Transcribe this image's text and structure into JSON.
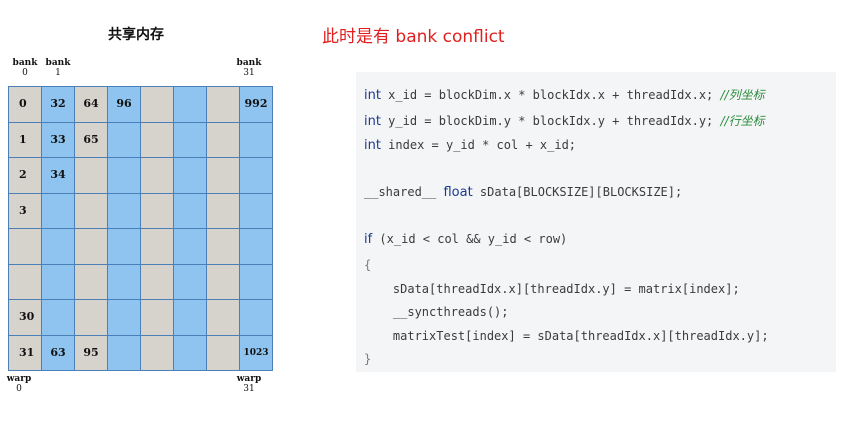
{
  "diagram_title": "共享内存",
  "headline": "此时是有 bank conflict",
  "bank_labels": {
    "b0": {
      "label": "bank",
      "num": "0"
    },
    "b1": {
      "label": "bank",
      "num": "1"
    },
    "b31": {
      "label": "bank",
      "num": "31"
    }
  },
  "warp_labels": {
    "w0": {
      "label": "warp",
      "num": "0"
    },
    "w31": {
      "label": "warp",
      "num": "31"
    }
  },
  "colors": {
    "blue": "#8ec4ef",
    "gray": "#d6d3cd",
    "border": "#4a7fb8",
    "headline": "#e02020",
    "code_bg": "#f4f5f7",
    "keyword": "#1a3a8c",
    "comment": "#2a8c3a"
  },
  "grid": {
    "rows": 8,
    "cols": 8,
    "col_shading": [
      "gray",
      "blue",
      "gray",
      "blue",
      "gray",
      "blue",
      "gray",
      "blue"
    ],
    "cells": [
      [
        "0",
        "32",
        "64",
        "96",
        "",
        "",
        "",
        "992"
      ],
      [
        "1",
        "33",
        "65",
        "",
        "",
        "",
        "",
        ""
      ],
      [
        "2",
        "34",
        "",
        "",
        "",
        "",
        "",
        ""
      ],
      [
        "3",
        "",
        "",
        "",
        "",
        "",
        "",
        ""
      ],
      [
        "",
        "",
        "",
        "",
        "",
        "",
        "",
        ""
      ],
      [
        "",
        "",
        "",
        "",
        "",
        "",
        "",
        ""
      ],
      [
        "30",
        "",
        "",
        "",
        "",
        "",
        "",
        ""
      ],
      [
        "31",
        "63",
        "95",
        "",
        "",
        "",
        "",
        "1023"
      ]
    ]
  },
  "code": {
    "lines": [
      [
        {
          "t": "kw",
          "v": "int"
        },
        {
          "t": "pl",
          "v": " x_id = blockDim.x * blockIdx.x + threadIdx.x; "
        },
        {
          "t": "cm",
          "v": "//列坐标"
        }
      ],
      [
        {
          "t": "kw",
          "v": "int"
        },
        {
          "t": "pl",
          "v": " y_id = blockDim.y * blockIdx.y + threadIdx.y; "
        },
        {
          "t": "cm",
          "v": "//行坐标"
        }
      ],
      [
        {
          "t": "kw",
          "v": "int"
        },
        {
          "t": "pl",
          "v": " index = y_id * col + x_id;"
        }
      ],
      [],
      [
        {
          "t": "pl",
          "v": "__shared__ "
        },
        {
          "t": "kw",
          "v": "float"
        },
        {
          "t": "pl",
          "v": " sData[BLOCKSIZE][BLOCKSIZE];"
        }
      ],
      [],
      [
        {
          "t": "kw",
          "v": "if"
        },
        {
          "t": "pl",
          "v": " (x_id < col && y_id < row)"
        }
      ],
      [
        {
          "t": "pu",
          "v": "{"
        }
      ],
      [
        {
          "t": "pl",
          "v": "    sData[threadIdx.x][threadIdx.y] = matrix[index];"
        }
      ],
      [
        {
          "t": "pl",
          "v": "    __syncthreads();"
        }
      ],
      [
        {
          "t": "pl",
          "v": "    matrixTest[index] = sData[threadIdx.x][threadIdx.y];"
        }
      ],
      [
        {
          "t": "pu",
          "v": "}"
        }
      ]
    ]
  }
}
